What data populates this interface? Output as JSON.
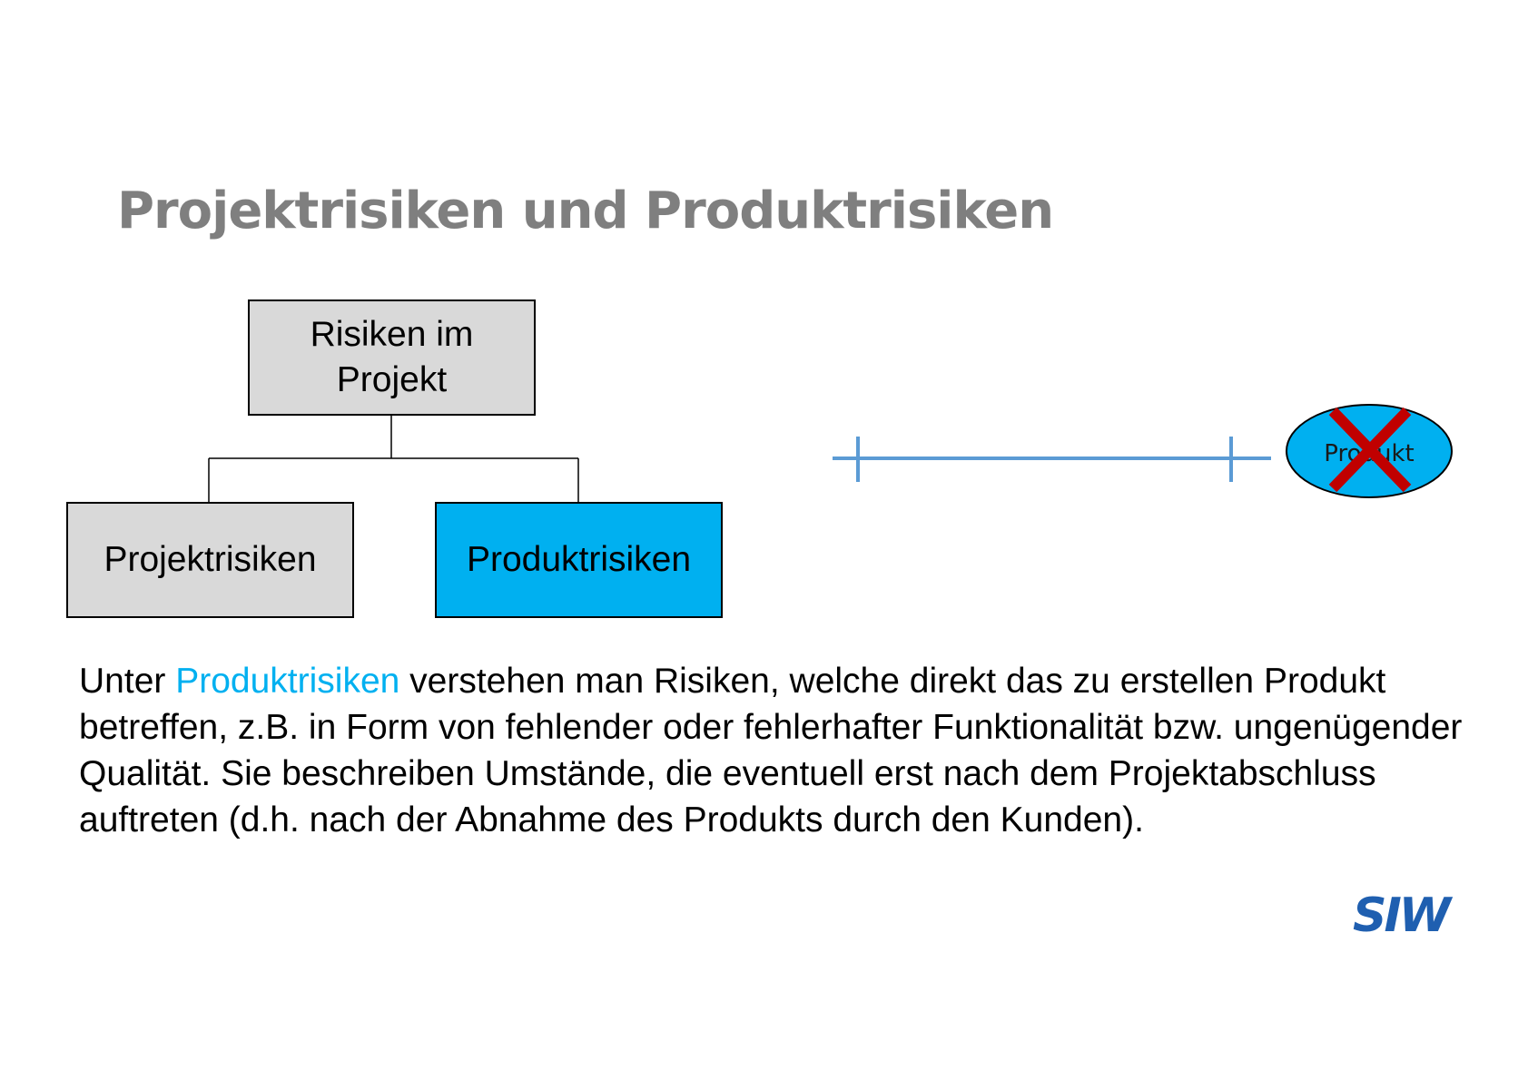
{
  "slide": {
    "title": "Projektrisiken und Produktrisiken"
  },
  "diagram": {
    "root": "Risiken im Projekt",
    "children": [
      {
        "label": "Projektrisiken",
        "fill": "#d9d9d9"
      },
      {
        "label": "Produktrisiken",
        "fill": "#00b0f0"
      }
    ],
    "timeline": {
      "line_color": "#5b9bd5",
      "end_node_label": "Produkt",
      "end_node_fill": "#00b0f0",
      "cross_color": "#c00000"
    }
  },
  "body": {
    "prefix": "Unter",
    "highlight": "Produktrisiken",
    "highlight_color": "#00b0f0",
    "suffix": "verstehen man Risiken, welche direkt das zu erstellen Produkt betreffen, z.B. in Form von fehlender oder fehlerhafter Funktionalität bzw. ungenügender Qualität. Sie beschreiben Umstände, die eventuell erst nach dem Projektabschluss auftreten (d.h. nach der Abnahme des Produkts durch den Kunden)."
  },
  "logo": {
    "text": "SIW",
    "color": "#1f5fb0"
  }
}
